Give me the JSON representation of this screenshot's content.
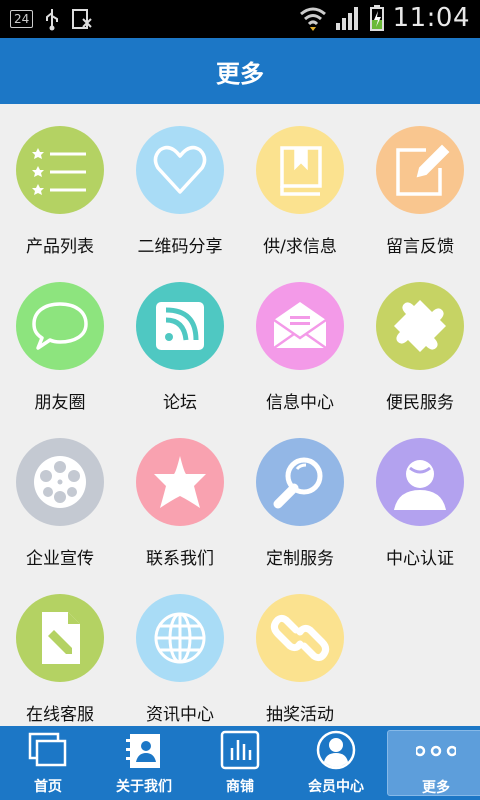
{
  "status_bar": {
    "badge": "24",
    "time": "11:04"
  },
  "header": {
    "title": "更多"
  },
  "grid": [
    {
      "label": "产品列表",
      "icon": "list-stars-icon",
      "color": "#b4d263"
    },
    {
      "label": "二维码分享",
      "icon": "heart-icon",
      "color": "#a9dcf6"
    },
    {
      "label": "供/求信息",
      "icon": "book-icon",
      "color": "#fbe28f"
    },
    {
      "label": "留言反馈",
      "icon": "edit-icon",
      "color": "#f9c68f"
    },
    {
      "label": "朋友圈",
      "icon": "speech-bubble-icon",
      "color": "#8de47e"
    },
    {
      "label": "论坛",
      "icon": "rss-icon",
      "color": "#4fc8c2"
    },
    {
      "label": "信息中心",
      "icon": "envelope-icon",
      "color": "#f39ae8"
    },
    {
      "label": "便民服务",
      "icon": "puzzle-icon",
      "color": "#c6d364"
    },
    {
      "label": "企业宣传",
      "icon": "film-reel-icon",
      "color": "#c4c9d2"
    },
    {
      "label": "联系我们",
      "icon": "star-icon",
      "color": "#f9a2b0"
    },
    {
      "label": "定制服务",
      "icon": "magnifier-icon",
      "color": "#93b7e6"
    },
    {
      "label": "中心认证",
      "icon": "user-icon",
      "color": "#b3a2ef"
    },
    {
      "label": "在线客服",
      "icon": "document-edit-icon",
      "color": "#b4d263"
    },
    {
      "label": "资讯中心",
      "icon": "globe-icon",
      "color": "#a9dcf6"
    },
    {
      "label": "抽奖活动",
      "icon": "link-icon",
      "color": "#fbe28f"
    }
  ],
  "tabbar": [
    {
      "label": "首页",
      "icon": "home-windows-icon"
    },
    {
      "label": "关于我们",
      "icon": "contact-card-icon"
    },
    {
      "label": "商铺",
      "icon": "chart-bars-icon"
    },
    {
      "label": "会员中心",
      "icon": "member-avatar-icon"
    },
    {
      "label": "更多",
      "icon": "more-dots-icon",
      "active": true
    }
  ]
}
